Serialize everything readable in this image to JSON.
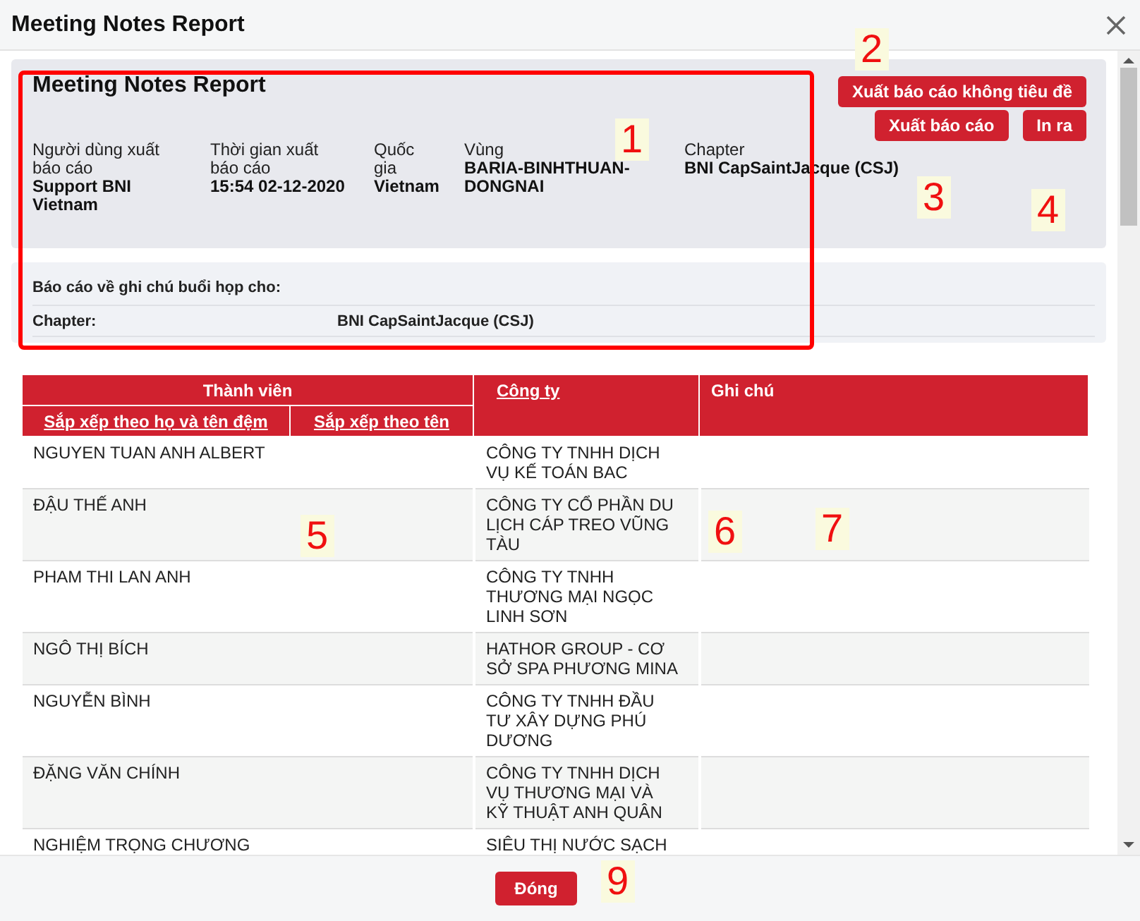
{
  "dialog": {
    "title": "Meeting Notes Report"
  },
  "report": {
    "title": "Meeting Notes Report",
    "info": [
      {
        "label": "Người dùng xuất báo cáo",
        "value": "Support BNI Vietnam"
      },
      {
        "label": "Thời gian xuất báo cáo",
        "value": "15:54 02-12-2020"
      },
      {
        "label": "Quốc gia",
        "value": "Vietnam"
      },
      {
        "label": "Vùng",
        "value": "BARIA-BINHTHUAN-DONGNAI"
      },
      {
        "label": "Chapter",
        "value": "BNI CapSaintJacque (CSJ)"
      }
    ],
    "buttons": [
      "Xuất báo cáo không tiêu đề",
      "Xuất báo cáo",
      "In ra"
    ]
  },
  "summary": {
    "heading": "Báo cáo về ghi chú buổi họp cho:",
    "rows": [
      {
        "label": "Chapter:",
        "value": "BNI CapSaintJacque (CSJ)"
      }
    ]
  },
  "table": {
    "member_header": "Thành viên",
    "sort_links": [
      "Sắp xếp theo họ và tên đệm",
      "Sắp xếp theo tên"
    ],
    "company_header": "Công ty",
    "notes_header": "Ghi chú",
    "rows": [
      {
        "member": "NGUYEN TUAN ANH ALBERT",
        "company": "CÔNG TY TNHH DỊCH VỤ KẾ TOÁN BAC"
      },
      {
        "member": "ĐẬU THẾ ANH",
        "company": "CÔNG TY CỔ PHẦN DU LỊCH CÁP TREO VŨNG TÀU"
      },
      {
        "member": "PHAM THI LAN ANH",
        "company": "CÔNG TY TNHH THƯƠNG MẠI NGỌC LINH SƠN"
      },
      {
        "member": "NGÔ THỊ BÍCH",
        "company": "HATHOR GROUP - CƠ SỞ SPA PHƯƠNG MINA"
      },
      {
        "member": "NGUYỄN BÌNH",
        "company": "CÔNG TY TNHH ĐẦU TƯ XÂY DỰNG PHÚ DƯƠNG"
      },
      {
        "member": "ĐẶNG VĂN CHÍNH",
        "company": "CÔNG TY TNHH DỊCH VỤ THƯƠNG MẠI VÀ KỸ THUẬT ANH QUÂN"
      },
      {
        "member": "NGHIỆM TRỌNG CHƯƠNG",
        "company": "SIÊU THỊ NƯỚC SẠCH"
      }
    ]
  },
  "footer": {
    "button": "Đóng"
  },
  "annotations": {
    "labels": [
      "1",
      "2",
      "3",
      "4",
      "5",
      "6",
      "7",
      "9"
    ]
  }
}
